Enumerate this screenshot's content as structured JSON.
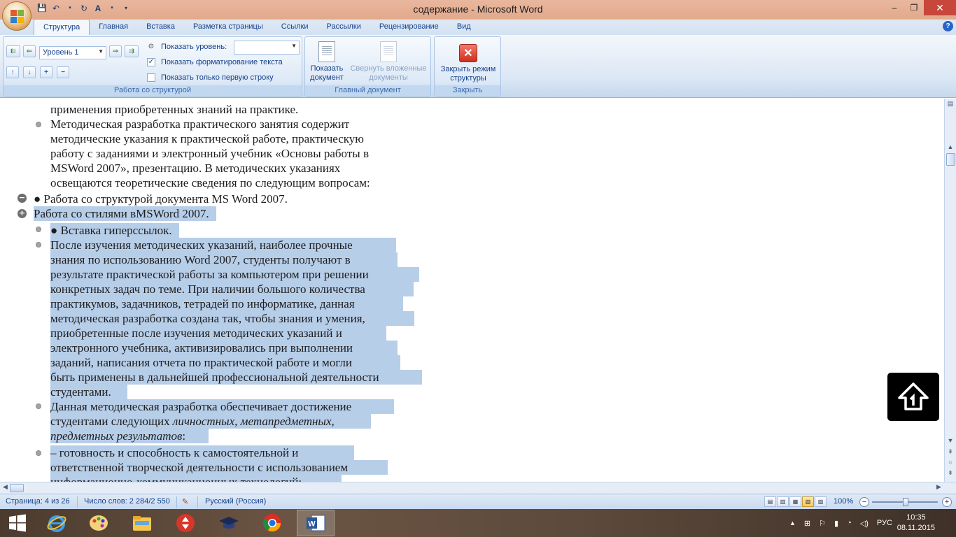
{
  "window": {
    "title": "содержание - Microsoft Word",
    "minimize": "–",
    "maximize": "❐",
    "close": "✕"
  },
  "qat": {
    "save": "💾",
    "undo": "↶",
    "redo": "↻",
    "check": "A"
  },
  "tabs": [
    "Структура",
    "Главная",
    "Вставка",
    "Разметка страницы",
    "Ссылки",
    "Рассылки",
    "Рецензирование",
    "Вид"
  ],
  "ribbon": {
    "outline_tools": {
      "level_value": "Уровень 1",
      "show_level_label": "Показать уровень:",
      "show_formatting_label": "Показать форматирование текста",
      "show_first_line_label": "Показать только первую строку",
      "group_label": "Работа со структурой"
    },
    "master_document": {
      "show_document_label": "Показать документ",
      "collapse_subdocs_label": "Свернуть вложенные документы",
      "group_label": "Главный документ"
    },
    "close": {
      "close_outline_label": "Закрыть режим структуры",
      "group_label": "Закрыть"
    }
  },
  "document": {
    "lines": [
      "применения приобретенных знаний на практике.",
      "Методическая разработка практического занятия содержит",
      "методические указания к практической работе, практическую",
      "работу с заданиями и электронный учебник «Основы работы в",
      "MSWord 2007», презентацию. В методических указаниях",
      "освещаются теоретические сведения по следующим вопросам:",
      "●  Работа со структурой документа MS Word 2007.",
      "Работа со стилями вMSWord 2007.",
      "●          Вставка гиперссылок.",
      "После изучения методических указаний, наиболее прочные",
      "знания по использованию Word 2007, студенты получают в",
      "результате практической работы за компьютером при решении",
      "конкретных задач по теме. При наличии большого количества",
      "практикумов, задачников, тетрадей по информатике, данная",
      "методическая разработка создана так, чтобы знания и умения,",
      "приобретенные после изучения методических указаний и",
      "электронного учебника, активизировались при выполнении",
      "заданий, написания отчета по практической работе и могли",
      "быть применены в дальнейшей профессиональной деятельности",
      "студентами.",
      "Данная методическая разработка обеспечивает достижение",
      "студентами следующих ",
      "личностных, метапредметных,",
      "предметных результатов",
      ":",
      "–         готовность и способность к самостоятельной и",
      "ответственной творческой деятельности с использованием",
      "информационно-коммуникационных технологий;"
    ]
  },
  "statusbar": {
    "page": "Страница: 4 из 26",
    "words": "Число слов: 2 284/2 550",
    "language": "Русский (Россия)",
    "zoom": "100%"
  },
  "taskbar": {
    "lang": "РУС",
    "time": "10:35",
    "date": "08.11.2015"
  },
  "colors": {
    "selection": "#b7cee9",
    "ribbon_text": "#15428b",
    "title_bar": "#e2a98c"
  }
}
